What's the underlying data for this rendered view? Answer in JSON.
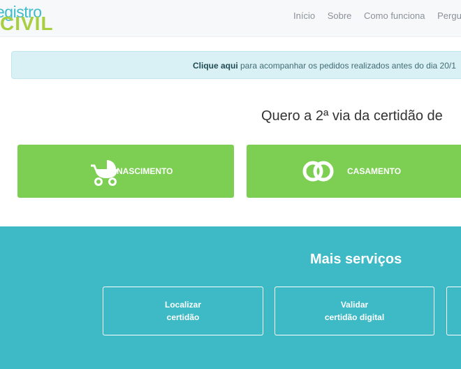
{
  "header": {
    "logo_top": "egistro",
    "logo_bottom": "CIVIL",
    "nav": [
      "Início",
      "Sobre",
      "Como funciona",
      "Perguntas"
    ]
  },
  "notice": {
    "link": "Clique aqui",
    "text": " para acompanhar os pedidos realizados antes do dia 20/1"
  },
  "heading": "Quero a 2ª via da certidão de",
  "cards": {
    "nascimento": {
      "label": "NASCIMENTO",
      "icon": "baby-carriage-icon"
    },
    "casamento": {
      "label": "CASAMENTO",
      "icon": "wedding-rings-icon"
    }
  },
  "services": {
    "title": "Mais serviços",
    "items": [
      {
        "line1": "Localizar",
        "line2": "certidão"
      },
      {
        "line1": "Validar",
        "line2": "certidão digital"
      }
    ]
  },
  "colors": {
    "card_green": "#7ccf52",
    "services_teal": "#3dbac6",
    "notice_bg": "#d9f0f4",
    "logo_blue": "#3fbccc",
    "logo_green": "#a7cf3f"
  }
}
